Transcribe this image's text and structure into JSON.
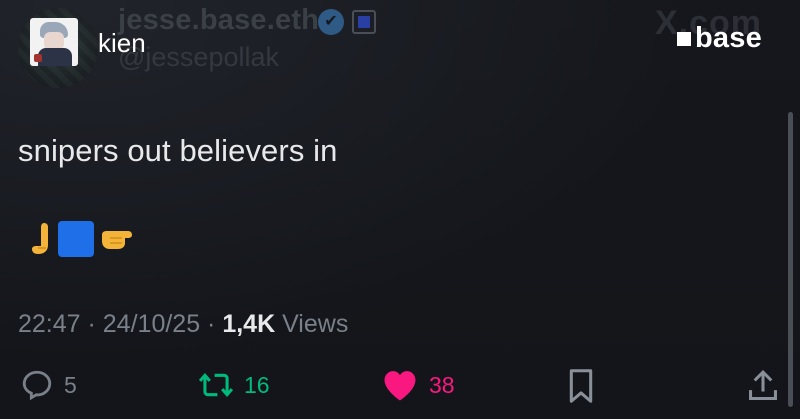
{
  "overlay": {
    "username": "kien",
    "brand": "base"
  },
  "background_tweet": {
    "display_name": "jesse.base.eth",
    "verified_mark": "✔",
    "handle": "@jessepollak",
    "site_logo": "X.com"
  },
  "tweet": {
    "text": "snipers out believers in",
    "emojis": [
      "thumb-icon",
      "blue-square-icon",
      "left-fist-icon"
    ],
    "time": "22:47",
    "sep1": " · ",
    "date": "24/10/25",
    "sep2": " · ",
    "views_count": "1,4K",
    "views_label": " Views"
  },
  "actions": {
    "replies": "5",
    "reposts": "16",
    "likes": "38"
  },
  "colors": {
    "background": "#16181d",
    "repost": "#00ba7c",
    "like": "#f91880",
    "muted": "#7a8089",
    "emoji_blue": "#1f6fe8"
  }
}
